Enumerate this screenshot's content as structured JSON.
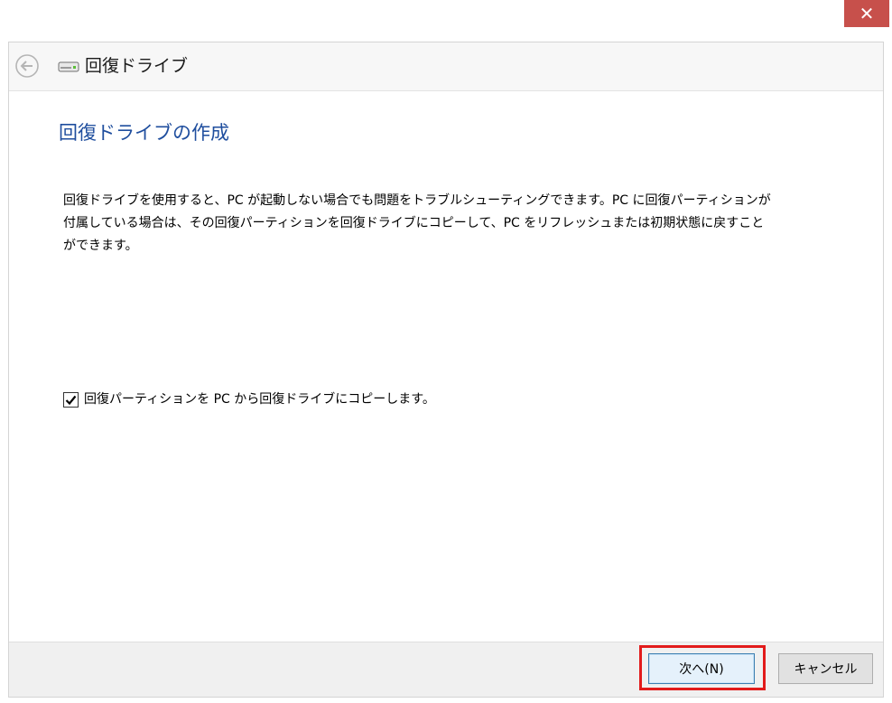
{
  "window": {
    "close_glyph": "✕",
    "nav_title": "回復ドライブ"
  },
  "main": {
    "heading": "回復ドライブの作成",
    "description": "回復ドライブを使用すると、PC が起動しない場合でも問題をトラブルシューティングできます。PC に回復パーティションが付属している場合は、その回復パーティションを回復ドライブにコピーして、PC をリフレッシュまたは初期状態に戻すことができます。",
    "checkbox": {
      "label": "回復パーティションを PC から回復ドライブにコピーします。",
      "checked": true,
      "check_glyph": "✔"
    }
  },
  "footer": {
    "next_label": "次へ(N)",
    "cancel_label": "キャンセル"
  },
  "colors": {
    "accent_heading": "#1f4e9e",
    "close_button": "#c7504b",
    "highlight": "#e21b1b"
  }
}
